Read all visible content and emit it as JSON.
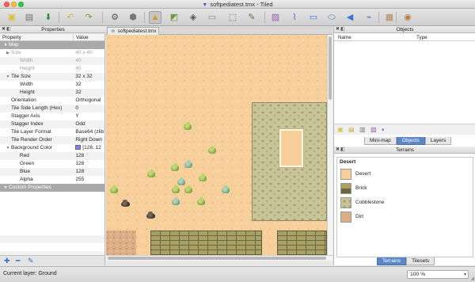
{
  "window": {
    "title": "softpediatest.tmx - Tiled"
  },
  "toolbar": {
    "items": [
      {
        "icon": "new-file-icon",
        "glyph": "▣",
        "color": "#d9c044"
      },
      {
        "icon": "open-folder-icon",
        "glyph": "▤",
        "color": "#6f6f6f"
      },
      {
        "icon": "save-icon",
        "glyph": "⬇",
        "color": "#2f8f3f"
      },
      {
        "icon": "undo-icon",
        "glyph": "↶",
        "color": "#d8b43a"
      },
      {
        "icon": "redo-icon",
        "glyph": "↷",
        "color": "#62a83b"
      },
      {
        "icon": "command-gear-icon",
        "glyph": "⚙",
        "color": "#555555"
      },
      {
        "icon": "random-dice-icon",
        "glyph": "⬢",
        "color": "#777777"
      },
      {
        "icon": "stamp-brush-icon",
        "glyph": "▲",
        "color": "#d09a2a"
      },
      {
        "icon": "terrain-brush-icon",
        "glyph": "◩",
        "color": "#6a9a3a"
      },
      {
        "icon": "bucket-fill-icon",
        "glyph": "◈",
        "color": "#555555"
      },
      {
        "icon": "eraser-icon",
        "glyph": "▭",
        "color": "#8a8a8a"
      },
      {
        "icon": "rect-select-icon",
        "glyph": "⬚",
        "color": "#666666"
      },
      {
        "icon": "magic-wand-icon",
        "glyph": "✎",
        "color": "#7a6a4a"
      },
      {
        "icon": "select-objects-icon",
        "glyph": "▨",
        "color": "#9060b0"
      },
      {
        "icon": "edit-polygon-icon",
        "glyph": "⌇",
        "color": "#4a6fb0"
      },
      {
        "icon": "insert-rectangle-icon",
        "glyph": "▭",
        "color": "#3b78d0"
      },
      {
        "icon": "insert-ellipse-icon",
        "glyph": "⬭",
        "color": "#3b78d0"
      },
      {
        "icon": "insert-polygon-icon",
        "glyph": "◀",
        "color": "#3b78d0"
      },
      {
        "icon": "insert-polyline-icon",
        "glyph": "⌁",
        "color": "#3b78d0"
      },
      {
        "icon": "insert-tile-icon",
        "glyph": "▦",
        "color": "#b08a5a"
      },
      {
        "icon": "close-world-icon",
        "glyph": "◉",
        "color": "#c07a3a"
      }
    ]
  },
  "properties": {
    "title": "Properties",
    "col_property": "Property",
    "col_value": "Value",
    "rows": [
      {
        "name": "Map",
        "value": "",
        "kind": "group"
      },
      {
        "name": "Size",
        "value": "40 x 40",
        "kind": "dim-caret"
      },
      {
        "name": "Width",
        "value": "40",
        "kind": "dim-sub"
      },
      {
        "name": "Height",
        "value": "40",
        "kind": "dim-sub"
      },
      {
        "name": "Tile Size",
        "value": "32 x 32",
        "kind": "caret"
      },
      {
        "name": "Width",
        "value": "32",
        "kind": "sub"
      },
      {
        "name": "Height",
        "value": "32",
        "kind": "sub"
      },
      {
        "name": "Orientation",
        "value": "Orthogonal",
        "kind": "plain"
      },
      {
        "name": "Tile Side Length (Hex)",
        "value": "0",
        "kind": "plain"
      },
      {
        "name": "Stagger Axis",
        "value": "Y",
        "kind": "plain"
      },
      {
        "name": "Stagger Index",
        "value": "Odd",
        "kind": "plain"
      },
      {
        "name": "Tile Layer Format",
        "value": "Base64 (zlib",
        "kind": "plain"
      },
      {
        "name": "Tile Render Order",
        "value": "Right Down",
        "kind": "plain"
      },
      {
        "name": "Background Color",
        "value": "[128, 12",
        "kind": "color"
      },
      {
        "name": "Red",
        "value": "128",
        "kind": "sub"
      },
      {
        "name": "Green",
        "value": "128",
        "kind": "sub"
      },
      {
        "name": "Blue",
        "value": "128",
        "kind": "sub"
      },
      {
        "name": "Alpha",
        "value": "255",
        "kind": "sub"
      },
      {
        "name": "Custom Properties",
        "value": "",
        "kind": "group"
      }
    ],
    "swatch_color": "#8080ff"
  },
  "map_tab": {
    "label": "softpediatest.tmx"
  },
  "objects": {
    "title": "Objects",
    "col_name": "Name",
    "col_type": "Type",
    "tabs": [
      "Mini-map",
      "Objects",
      "Layers"
    ],
    "selected_tab": "Objects"
  },
  "terrains": {
    "title": "Terrains",
    "tileset_name": "Desert",
    "items": [
      {
        "label": "Desert",
        "swatch": "desert"
      },
      {
        "label": "Brick",
        "swatch": "brick"
      },
      {
        "label": "Cobblestone",
        "swatch": "cobble"
      },
      {
        "label": "Dirt",
        "swatch": "dirt"
      }
    ],
    "tabs": [
      "Terrains",
      "Tilesets"
    ],
    "selected_tab": "Terrains"
  },
  "status": {
    "current_layer": "Current layer: Ground",
    "zoom": "100 %"
  }
}
